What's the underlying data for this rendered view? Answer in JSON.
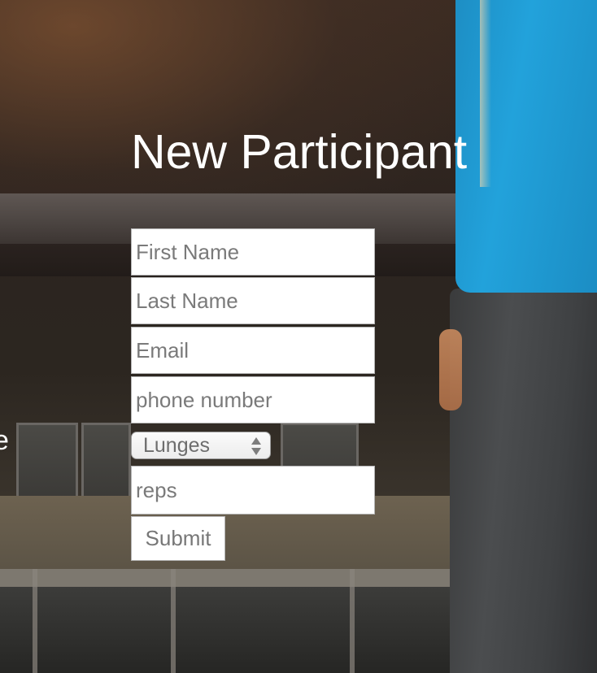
{
  "page": {
    "title": "New Participant",
    "edge_text": "e"
  },
  "form": {
    "first_name": {
      "placeholder": "First Name",
      "value": ""
    },
    "last_name": {
      "placeholder": "Last Name",
      "value": ""
    },
    "email": {
      "placeholder": "Email",
      "value": ""
    },
    "phone": {
      "placeholder": "phone number",
      "value": ""
    },
    "exercise_select": {
      "selected": "Lunges",
      "icon": "up-down-arrows-icon"
    },
    "reps": {
      "placeholder": "reps",
      "value": ""
    },
    "submit_label": "Submit"
  },
  "colors": {
    "title_text": "#ffffff",
    "field_background": "#ffffff",
    "field_border": "#b5b5b5",
    "placeholder_text": "#7a7a7a",
    "shirt_blue": "#22a2db"
  }
}
